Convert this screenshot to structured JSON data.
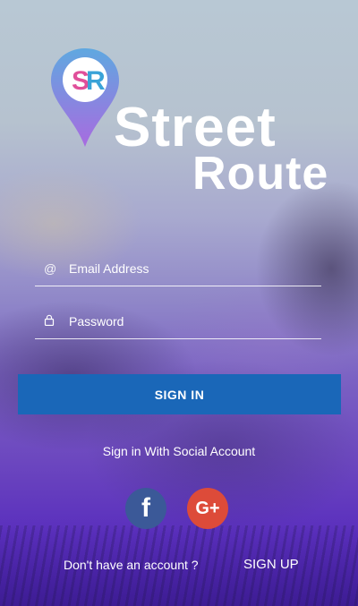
{
  "logo": {
    "badge_s": "S",
    "badge_r": "R",
    "brand_line1": "Street",
    "brand_line2": "Route"
  },
  "form": {
    "email_icon": "@",
    "email_placeholder": "Email Address",
    "email_value": "",
    "password_icon": "lock-icon",
    "password_placeholder": "Password",
    "password_value": "",
    "signin_label": "SIGN IN"
  },
  "social": {
    "label": "Sign in With Social Account",
    "facebook_glyph": "f",
    "google_glyph": "G+"
  },
  "footer": {
    "question": "Don't have an account ?",
    "signup_label": "SIGN UP"
  },
  "colors": {
    "button": "#1a67b8",
    "facebook": "#3b5998",
    "google": "#dd4b39",
    "pin_top": "#5fa8e0",
    "pin_bottom": "#a86be0"
  }
}
